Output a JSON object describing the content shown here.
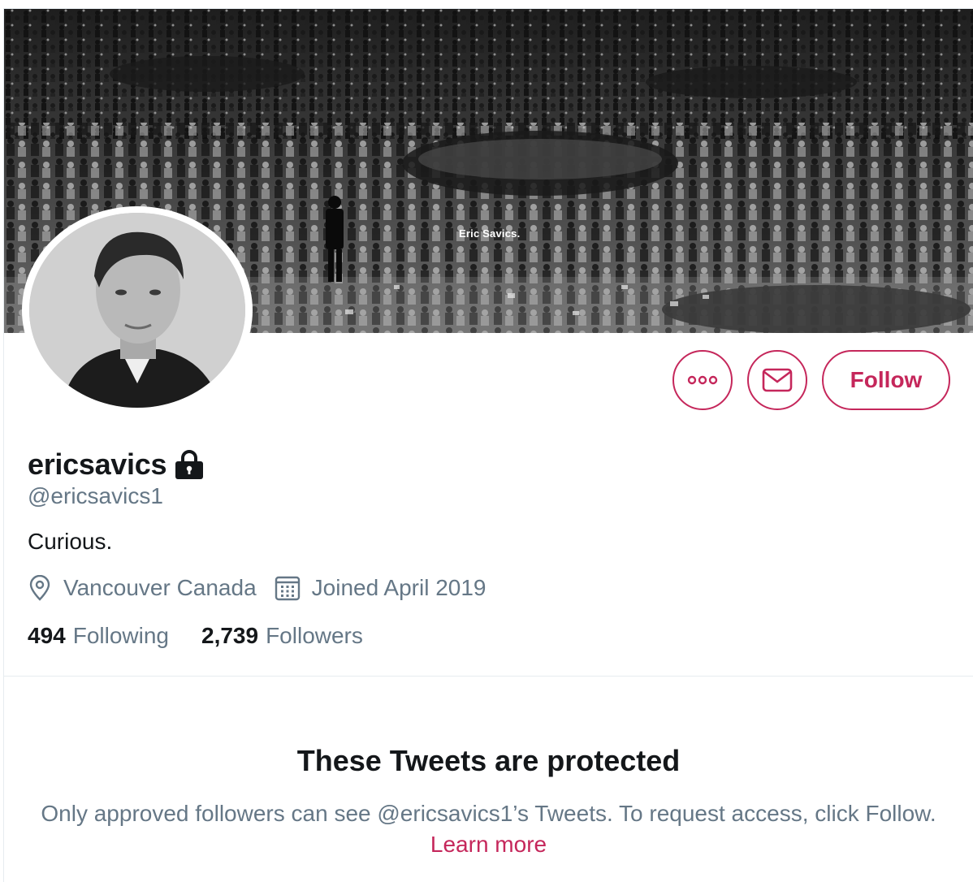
{
  "banner": {
    "caption": "Eric Savics.",
    "alt": "black and white photo of a crowded trading floor"
  },
  "profile": {
    "display_name": "ericsavics",
    "handle": "@ericsavics1",
    "bio": "Curious.",
    "location": "Vancouver Canada",
    "joined": "Joined April 2019",
    "locked_icon": "lock-icon"
  },
  "actions": {
    "more_icon": "more-icon",
    "message_icon": "envelope-icon",
    "follow_label": "Follow"
  },
  "stats": {
    "following_count": "494",
    "following_label": "Following",
    "followers_count": "2,739",
    "followers_label": "Followers"
  },
  "protected": {
    "title": "These Tweets are protected",
    "text": "Only approved followers can see @ericsavics1’s Tweets. To request access, click Follow.",
    "learn_more": "Learn more"
  },
  "colors": {
    "accent": "#c5275b",
    "secondary_text": "#657786",
    "primary_text": "#14171a",
    "divider": "#e6ecf0"
  }
}
